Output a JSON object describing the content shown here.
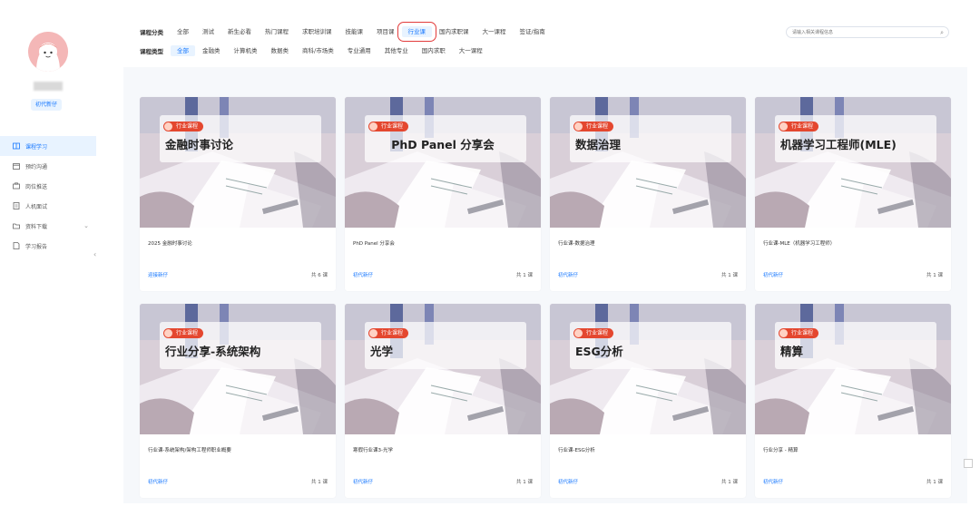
{
  "sidebar": {
    "badge": "初代新仔",
    "nav": [
      {
        "label": "课程学习",
        "icon": "book-icon",
        "active": true
      },
      {
        "label": "预约沟通",
        "icon": "calendar-icon",
        "active": false
      },
      {
        "label": "岗位推送",
        "icon": "briefcase-icon",
        "active": false
      },
      {
        "label": "人机面试",
        "icon": "document-icon",
        "active": false
      },
      {
        "label": "资料下载",
        "icon": "folder-icon",
        "active": false
      },
      {
        "label": "学习报告",
        "icon": "report-icon",
        "active": false
      }
    ]
  },
  "filters": {
    "category_label": "课程分类",
    "categories": [
      "全部",
      "测试",
      "新生必看",
      "热门课程",
      "求职培训课",
      "技能课",
      "项目课",
      "行业课",
      "国内求职课",
      "大一课程",
      "签证/指南"
    ],
    "category_selected": "行业课",
    "type_label": "课程类型",
    "types": [
      "全部",
      "金融类",
      "计算机类",
      "数据类",
      "商科/市场类",
      "专业通用",
      "其他专业",
      "国内求职",
      "大一课程"
    ],
    "type_selected": "全部",
    "search_placeholder": "请输入相关课程信息"
  },
  "cards": [
    {
      "tag": "行业课程",
      "title": "金融时事讨论",
      "desc": "2025 金融时事讨论",
      "category": "迎接新仔",
      "count": "共 6 课"
    },
    {
      "tag": "行业课程",
      "title": "PhD Panel 分享会",
      "desc": "PhD Panel 分享会",
      "category": "初代新仔",
      "count": "共 1 课"
    },
    {
      "tag": "行业课程",
      "title": "数据治理",
      "desc": "行业课-数据治理",
      "category": "初代新仔",
      "count": "共 1 课"
    },
    {
      "tag": "行业课程",
      "title": "机器学习工程师(MLE)",
      "desc": "行业课-MLE（机器学习工程师）",
      "category": "初代新仔",
      "count": "共 1 课"
    },
    {
      "tag": "行业课程",
      "title": "行业分享-系统架构",
      "desc": "行业课-系统架构/架构工程师职业概要",
      "category": "初代新仔",
      "count": "共 1 课"
    },
    {
      "tag": "行业课程",
      "title": "光学",
      "desc": "寒假行业课3-光学",
      "category": "初代新仔",
      "count": "共 1 课"
    },
    {
      "tag": "行业课程",
      "title": "ESG分析",
      "desc": "行业课-ESG分析",
      "category": "初代新仔",
      "count": "共 1 课"
    },
    {
      "tag": "行业课程",
      "title": "精算",
      "desc": "行业分享 - 精算",
      "category": "初代新仔",
      "count": "共 1 课"
    }
  ],
  "colors": {
    "accent": "#1677ff",
    "tag": "#e4472f",
    "highlight": "#e23b3b"
  }
}
